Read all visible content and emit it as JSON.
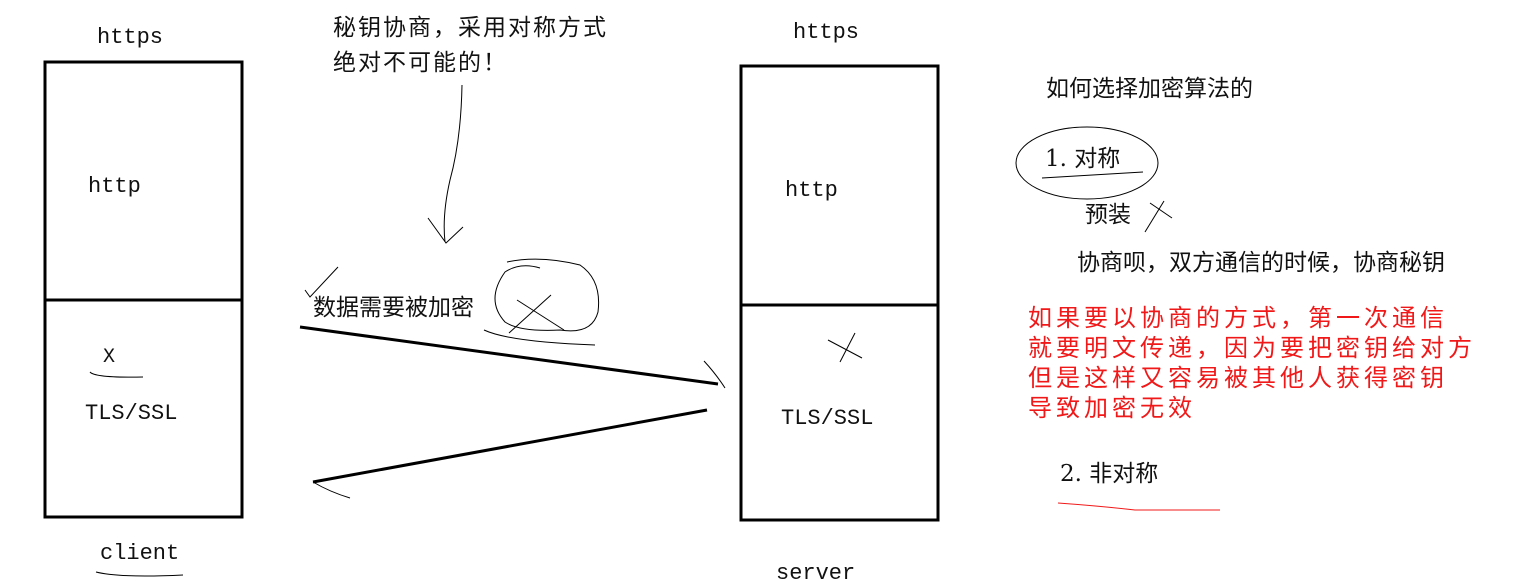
{
  "client": {
    "title": "https",
    "upper_layer": "http",
    "mark": "X",
    "lower_layer": "TLS/SSL",
    "label": "client"
  },
  "server": {
    "title": "https",
    "upper_layer": "http",
    "lower_layer": "TLS/SSL",
    "label": "server"
  },
  "middle": {
    "note_line1": "秘钥协商，采用对称方式",
    "note_line2": "绝对不可能的！",
    "data_label": "数据需要被加密"
  },
  "right": {
    "heading": "如何选择加密算法的",
    "option1": "1. 对称",
    "preinstall": "预装",
    "negotiate": "协商呗，双方通信的时候，协商秘钥",
    "warning_lines": [
      "如果要以协商的方式，第一次通信",
      "就要明文传递，因为要把密钥给对方",
      "但是这样又容易被其他人获得密钥",
      "导致加密无效"
    ],
    "option2": "2. 非对称"
  },
  "colors": {
    "ink": "#000000",
    "warning": "#f01818"
  }
}
